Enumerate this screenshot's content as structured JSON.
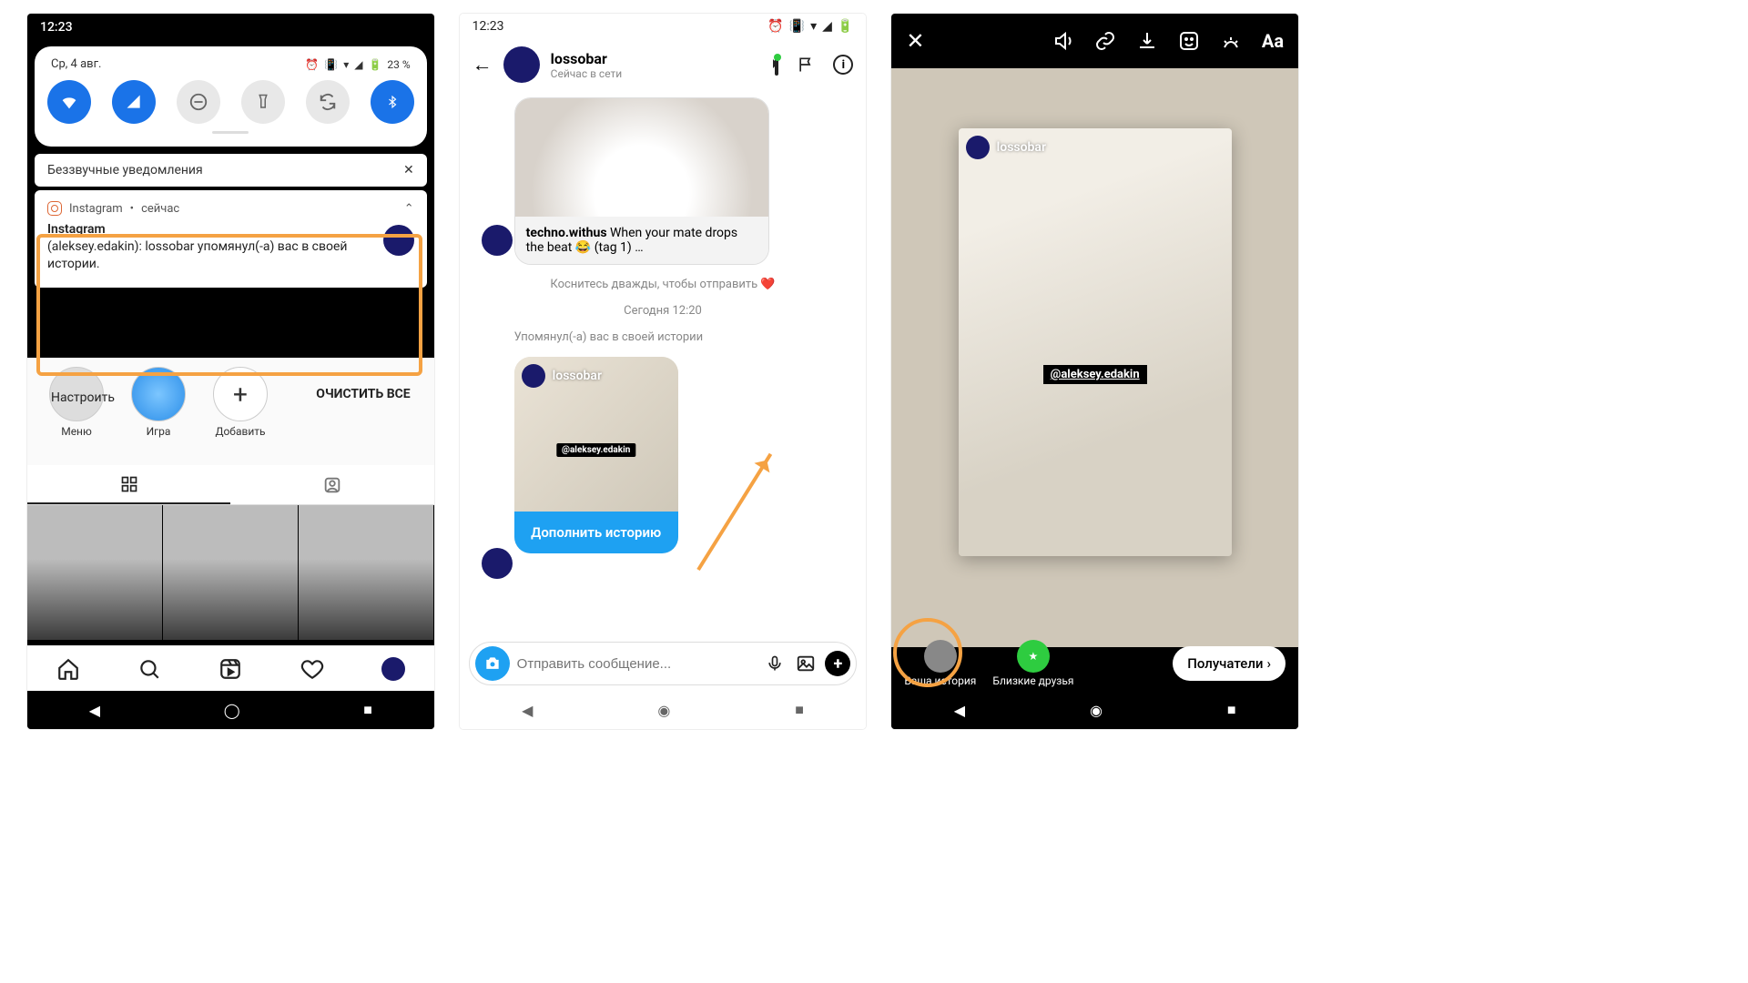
{
  "phone1": {
    "status_time": "12:23",
    "shade_date": "Ср, 4 авг.",
    "battery": "23 %",
    "silent_header": "Беззвучные уведомления",
    "notif_app": "Instagram",
    "notif_when": "сейчас",
    "notif_title": "Instagram",
    "notif_body": "(aleksey.edakin): lossobar упомянул(-а) вас в своей истории.",
    "settings_label": "Настроить",
    "clear_all": "ОЧИСТИТЬ ВСЕ",
    "highlights": [
      {
        "label": "Меню"
      },
      {
        "label": "Игра"
      },
      {
        "label": "Добавить"
      }
    ]
  },
  "phone2": {
    "status_time": "12:23",
    "header_name": "lossobar",
    "presence": "Сейчас в сети",
    "shared_user": "techno.withus",
    "shared_text": " When your mate drops the beat 😂 (tag 1) …",
    "tip": "Коснитесь дважды, чтобы отправить ❤️",
    "time_sep": "Сегодня 12:20",
    "mention_line": "Упомянул(-а) вас в своей истории",
    "story_user": "lossobar",
    "mention_tag": "@aleksey.edakin",
    "add_story_btn": "Дополнить историю",
    "input_placeholder": "Отправить сообщение..."
  },
  "phone3": {
    "repost_user": "lossobar",
    "mention_tag": "@aleksey.edakin",
    "your_story": "Ваша история",
    "close_friends": "Близкие друзья",
    "recipients": "Получатели",
    "text_tool": "Aa"
  }
}
